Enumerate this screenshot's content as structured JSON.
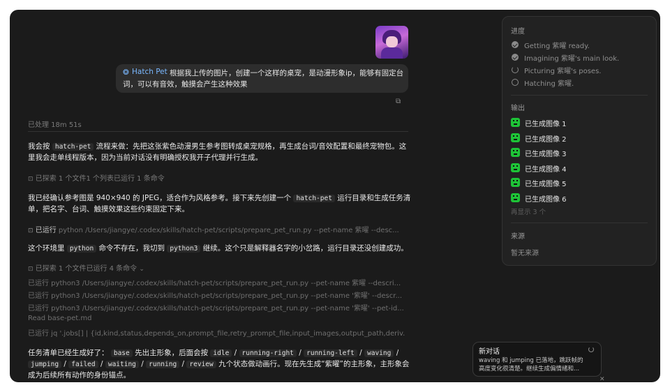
{
  "request": {
    "skill_label": "Hatch Pet",
    "text_line1": "根据我上传的图片，创建一个这样的桌宠，是动漫形象ip，能够有固定台",
    "text_line2": "词，可以有音效，触摸会产生这种效果"
  },
  "processed": "已处理 18m 51s",
  "paragraphs": {
    "p1": {
      "a": "我会按",
      "code": "hatch-pet",
      "b": "流程来做：先把这张紫色动漫男生参考图转成桌宠规格，再生成台词/音效配置和最终宠物包。这",
      "line2": "里我会走单线程版本，因为当前对话没有明确授权我开子代理并行生成。"
    },
    "explored1": "已探索 1 个文件1 个列表已运行 1 条命令",
    "p2": {
      "a": "我已经确认参考图是 940×940 的 JPEG，适合作为风格参考。接下来先创建一个",
      "code": "hatch-pet",
      "b": "运行目录和生成任务清",
      "line2": "单，把名字、台词、触摸效果这些约束固定下来。"
    },
    "ran1_label": "已运行",
    "ran1_cmd": "python /Users/jiangye/.codex/skills/hatch-pet/scripts/prepare_pet_run.py --pet-name 紫曜 --desc...",
    "p3": {
      "a": "这个环境里",
      "code1": "python",
      "b": "命令不存在，我切到",
      "code2": "python3",
      "c": "继续。这个只是解释器名字的小岔路，运行目录还没创建成功。"
    },
    "explored2": "已探索 1 个文件已运行 4 条命令",
    "commands": [
      "已运行 python3 /Users/jiangye/.codex/skills/hatch-pet/scripts/prepare_pet_run.py --pet-name 紫曜 --descri...",
      "已运行 python3 /Users/jiangye/.codex/skills/hatch-pet/scripts/prepare_pet_run.py --pet-name '紫曜' --descr...",
      "已运行 python3 /Users/jiangye/.codex/skills/hatch-pet/scripts/prepare_pet_run.py --pet-name '紫曜' --pet-id...",
      "Read base-pet.md",
      "已运行 jq '.jobs[] | {id,kind,status,depends_on,prompt_file,retry_prompt_file,input_images,output_path,deriv..."
    ],
    "p4": {
      "a": "任务清单已经生成好了：",
      "code0": "base",
      "b": "先出主形象，后面会按",
      "codes": [
        "idle",
        "running-right",
        "running-left",
        "waving",
        "jumping",
        "failed",
        "waiting",
        "running",
        "review"
      ],
      "sep": "/",
      "c": "九个状态做动画行。现在先生成“紫曜”的主形象，主形象会",
      "line3": "成为后续所有动作的身份锚点。"
    }
  },
  "panel": {
    "progress_title": "进度",
    "progress": [
      {
        "text": "Getting 紫曜 ready.",
        "status": "done"
      },
      {
        "text": "Imagining 紫曜's main look.",
        "status": "done"
      },
      {
        "text": "Picturing 紫曜's poses.",
        "status": "running"
      },
      {
        "text": "Hatching 紫曜.",
        "status": "pending"
      }
    ],
    "output_title": "输出",
    "outputs": [
      "已生成图像 1",
      "已生成图像 2",
      "已生成图像 3",
      "已生成图像 4",
      "已生成图像 5",
      "已生成图像 6"
    ],
    "more": "再显示 3 个",
    "source_title": "来源",
    "no_source": "暂无来源"
  },
  "toast": {
    "title": "新对话",
    "line1": "waving 和 jumping 已落地，跳跃帧的",
    "line2": "高度变化很清楚。继续生成偏情绪和..."
  },
  "colors": {
    "accent_green": "#1ec337",
    "skill_blue": "#7ab8ff"
  }
}
